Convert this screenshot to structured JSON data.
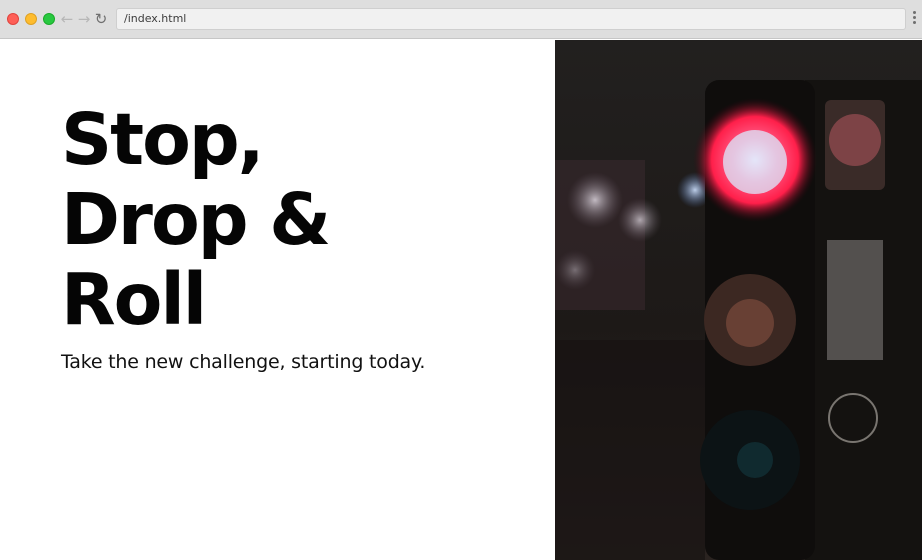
{
  "browser": {
    "url": "/index.html",
    "back_icon": "arrow-left-icon",
    "forward_icon": "arrow-right-icon",
    "reload_icon": "reload-icon",
    "menu_icon": "vertical-dots-icon"
  },
  "hero": {
    "title_lines": [
      "Stop,",
      "Drop &",
      "Roll"
    ],
    "subtitle": "Take the new challenge, starting today.",
    "image_subject": "red traffic light at night"
  },
  "colors": {
    "title": "#050505",
    "light_red": "#ff1f4a",
    "photo_bg": "#1a1512"
  }
}
